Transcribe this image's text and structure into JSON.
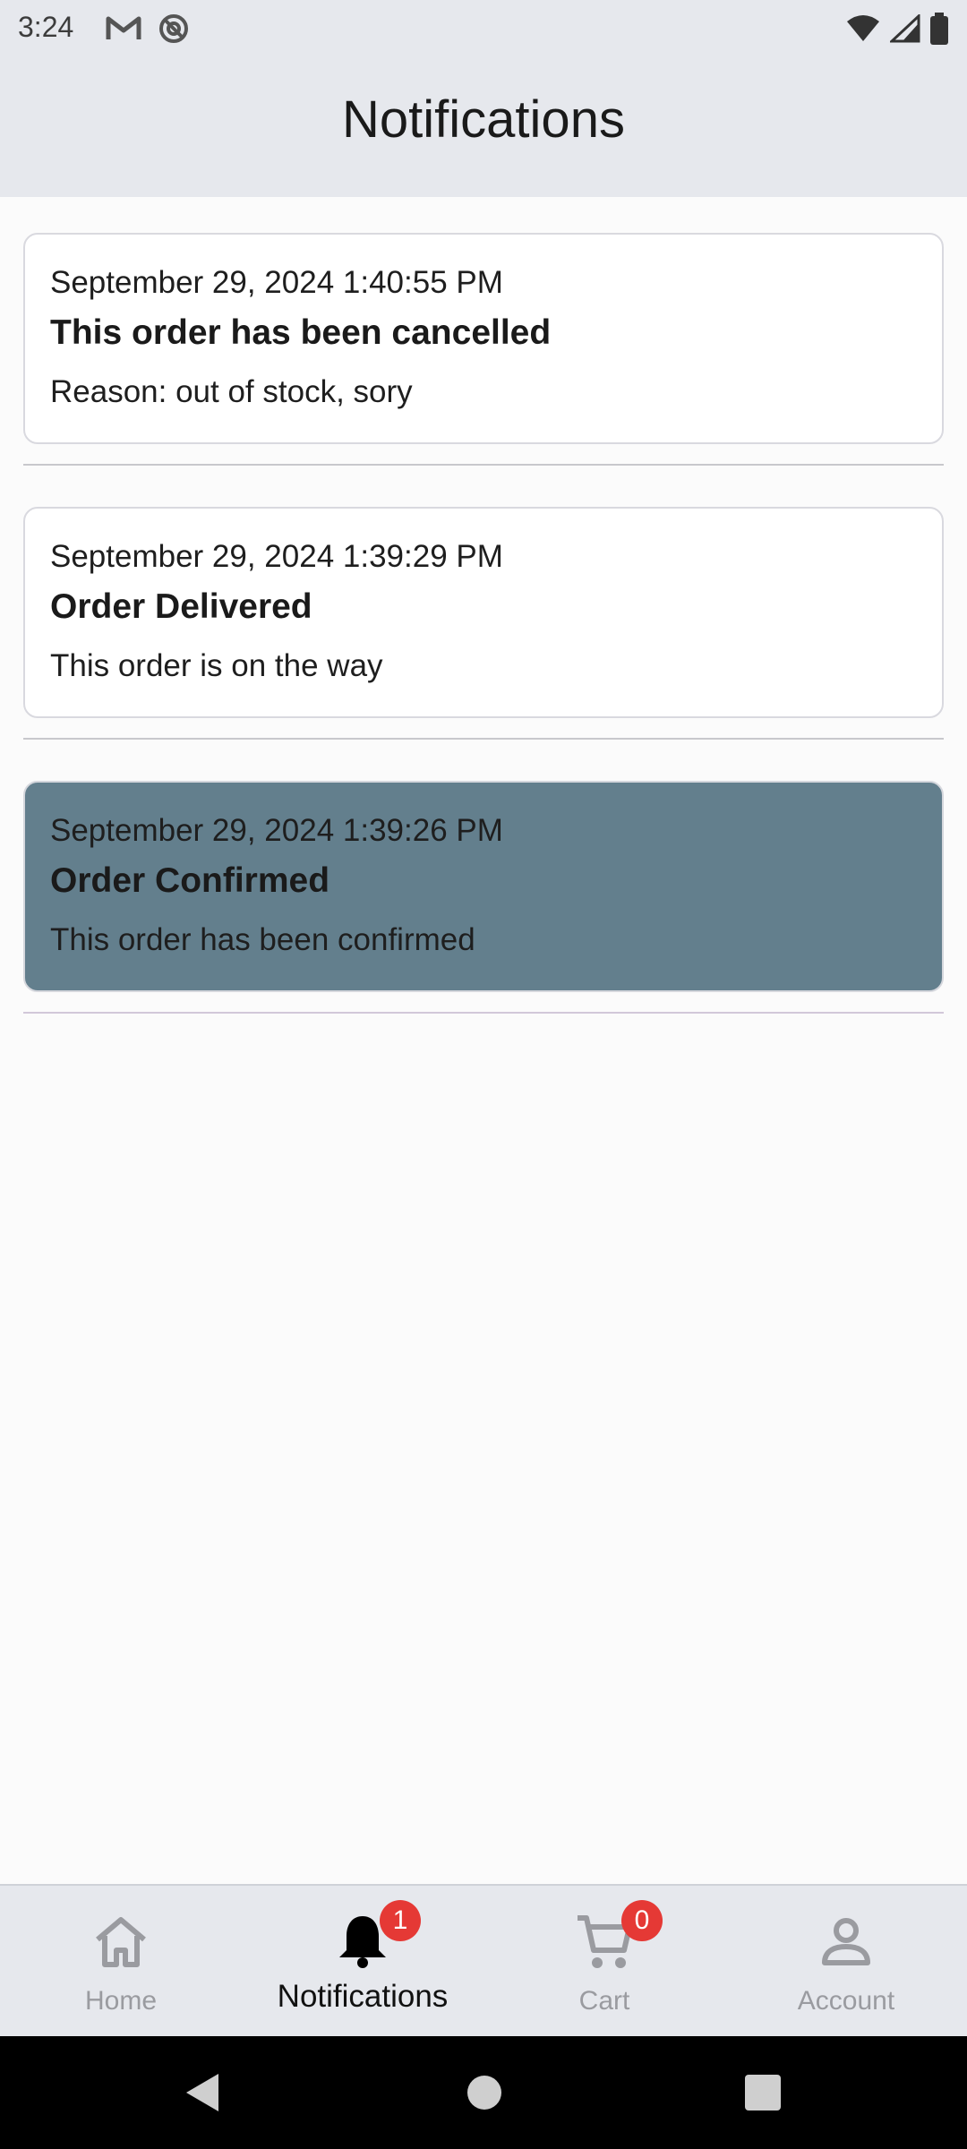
{
  "status_bar": {
    "time": "3:24",
    "left_icons": [
      "gmail-icon",
      "do-not-disturb-icon"
    ],
    "right_icons": [
      "wifi-icon",
      "signal-icon",
      "battery-icon"
    ]
  },
  "app_bar": {
    "title": "Notifications"
  },
  "notifications": [
    {
      "date": "September 29, 2024 1:40:55 PM",
      "title": "This order has been cancelled",
      "body": "Reason: out of stock, sory",
      "highlighted": false
    },
    {
      "date": "September 29, 2024 1:39:29 PM",
      "title": "Order Delivered",
      "body": "This order is on the way",
      "highlighted": false
    },
    {
      "date": "September 29, 2024 1:39:26 PM",
      "title": "Order Confirmed",
      "body": "This order has been confirmed",
      "highlighted": true
    }
  ],
  "bottom_nav": {
    "items": [
      {
        "label": "Home",
        "icon": "home-icon",
        "active": false
      },
      {
        "label": "Notifications",
        "icon": "bell-icon",
        "active": true,
        "badge": "1"
      },
      {
        "label": "Cart",
        "icon": "cart-icon",
        "active": false,
        "badge": "0"
      },
      {
        "label": "Account",
        "icon": "account-icon",
        "active": false
      }
    ]
  },
  "colors": {
    "app_bar_bg": "#e6e8ed",
    "highlight_card_bg": "#637f8d",
    "badge_bg": "#e53935",
    "inactive_nav": "#9a9ba0"
  }
}
